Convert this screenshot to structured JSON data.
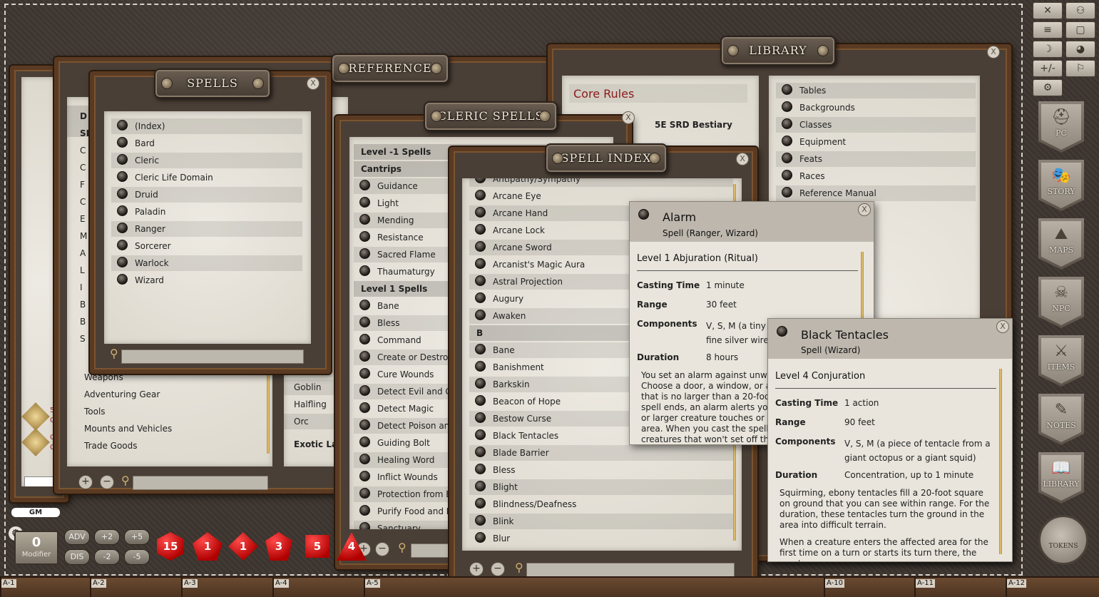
{
  "windows": {
    "spells": {
      "title": "SPELLS",
      "close": "X",
      "items": [
        "(Index)",
        "Bard",
        "Cleric",
        "Cleric Life Domain",
        "Druid",
        "Paladin",
        "Ranger",
        "Sorcerer",
        "Warlock",
        "Wizard"
      ]
    },
    "reference": {
      "title": "REFERENCE",
      "left_fragments": [
        "D",
        "SR",
        "C",
        "C",
        "F",
        "C",
        "E",
        "M",
        "A",
        "L",
        "I",
        "B",
        "B",
        "S"
      ],
      "items": [
        "Weapons",
        "Adventuring Gear",
        "Tools",
        "Mounts and Vehicles",
        "Trade Goods"
      ],
      "right_fragments": [
        "ng",
        "e",
        "ac",
        "er",
        "you",
        "a",
        "s",
        "th",
        "e",
        "cal",
        "e",
        "d L",
        "ge",
        "on",
        "sh"
      ],
      "right_items": [
        "Goblin",
        "Halfling",
        "Orc",
        "Exotic Lang"
      ]
    },
    "cleric_spells": {
      "title": "CLERIC SPELLS",
      "close": "X",
      "rows": [
        {
          "text": "Level -1 Spells",
          "kind": "header"
        },
        {
          "text": "Cantrips",
          "kind": "header"
        },
        {
          "text": "Guidance",
          "kind": "item"
        },
        {
          "text": "Light",
          "kind": "item"
        },
        {
          "text": "Mending",
          "kind": "item"
        },
        {
          "text": "Resistance",
          "kind": "item"
        },
        {
          "text": "Sacred Flame",
          "kind": "item"
        },
        {
          "text": "Thaumaturgy",
          "kind": "item"
        },
        {
          "text": "Level 1 Spells",
          "kind": "header"
        },
        {
          "text": "Bane",
          "kind": "item"
        },
        {
          "text": "Bless",
          "kind": "item"
        },
        {
          "text": "Command",
          "kind": "item"
        },
        {
          "text": "Create or Destroy Water",
          "kind": "item"
        },
        {
          "text": "Cure Wounds",
          "kind": "item"
        },
        {
          "text": "Detect Evil and Good",
          "kind": "item"
        },
        {
          "text": "Detect Magic",
          "kind": "item"
        },
        {
          "text": "Detect Poison and Disease",
          "kind": "item"
        },
        {
          "text": "Guiding Bolt",
          "kind": "item"
        },
        {
          "text": "Healing Word",
          "kind": "item"
        },
        {
          "text": "Inflict Wounds",
          "kind": "item"
        },
        {
          "text": "Protection from Evil and Good",
          "kind": "item"
        },
        {
          "text": "Purify Food and Drink",
          "kind": "item"
        },
        {
          "text": "Sanctuary",
          "kind": "item"
        }
      ]
    },
    "library": {
      "title": "LIBRARY",
      "close": "X",
      "left_header": "Core Rules",
      "left_items": [
        "5E SRD Bestiary"
      ],
      "right_items": [
        "Tables",
        "Backgrounds",
        "Classes",
        "Equipment",
        "Feats",
        "Races",
        "Reference Manual"
      ]
    },
    "spell_index": {
      "title": "SPELL INDEX",
      "close": "X",
      "rows": [
        {
          "text": "Antipathy/Sympathy",
          "kind": "item"
        },
        {
          "text": "Arcane Eye",
          "kind": "item"
        },
        {
          "text": "Arcane Hand",
          "kind": "item"
        },
        {
          "text": "Arcane Lock",
          "kind": "item"
        },
        {
          "text": "Arcane Sword",
          "kind": "item"
        },
        {
          "text": "Arcanist's Magic Aura",
          "kind": "item"
        },
        {
          "text": "Astral Projection",
          "kind": "item"
        },
        {
          "text": "Augury",
          "kind": "item"
        },
        {
          "text": "Awaken",
          "kind": "item"
        },
        {
          "text": "B",
          "kind": "header"
        },
        {
          "text": "Bane",
          "kind": "item"
        },
        {
          "text": "Banishment",
          "kind": "item"
        },
        {
          "text": "Barkskin",
          "kind": "item"
        },
        {
          "text": "Beacon of Hope",
          "kind": "item"
        },
        {
          "text": "Bestow Curse",
          "kind": "item"
        },
        {
          "text": "Black Tentacles",
          "kind": "item"
        },
        {
          "text": "Blade Barrier",
          "kind": "item"
        },
        {
          "text": "Bless",
          "kind": "item"
        },
        {
          "text": "Blight",
          "kind": "item"
        },
        {
          "text": "Blindness/Deafness",
          "kind": "item"
        },
        {
          "text": "Blink",
          "kind": "item"
        },
        {
          "text": "Blur",
          "kind": "item"
        }
      ]
    }
  },
  "popups": {
    "alarm": {
      "title": "Alarm",
      "subtitle": "Spell (Ranger, Wizard)",
      "level": "Level 1 Abjuration (Ritual)",
      "close": "X",
      "fields": [
        {
          "label": "Casting Time",
          "value": "1 minute"
        },
        {
          "label": "Range",
          "value": "30 feet"
        },
        {
          "label": "Components",
          "value": "V, S, M (a tiny bell and a piece of fine silver wire)"
        },
        {
          "label": "Duration",
          "value": "8 hours"
        }
      ],
      "description": "You set an alarm against unwanted intrusion. Choose a door, a window, or an area within range that is no larger than a 20-foot cube. Until the spell ends, an alarm alerts you whenever a Tiny or larger creature touches or enters the warded area. When you cast the spell, you can designate creatures that won't set off the alarm."
    },
    "black_tentacles": {
      "title": "Black Tentacles",
      "subtitle": "Spell (Wizard)",
      "level": "Level 4 Conjuration",
      "close": "X",
      "fields": [
        {
          "label": "Casting Time",
          "value": "1 action"
        },
        {
          "label": "Range",
          "value": "90 feet"
        },
        {
          "label": "Components",
          "value": "V, S, M (a piece of tentacle from a giant octopus or a giant squid)"
        },
        {
          "label": "Duration",
          "value": "Concentration, up to 1 minute"
        }
      ],
      "description": "Squirming, ebony tentacles fill a 20-foot square on ground that you can see within range. For the duration, these tentacles turn the ground in the area into difficult terrain.",
      "description2": "When a creature enters the affected area for the first time on a turn or starts its turn there, the creature"
    }
  },
  "chat": {
    "entries": [
      "5E",
      "Co",
      "Co",
      "Co"
    ],
    "gm_label": "GM"
  },
  "modifier": {
    "value": "0",
    "label": "Modifier"
  },
  "mod_buttons": [
    "ADV",
    "+2",
    "+5",
    "DIS",
    "-2",
    "-5"
  ],
  "dice": [
    "15",
    "1",
    "1",
    "3",
    "5",
    "4"
  ],
  "right_toolbar": {
    "buttons": [
      "✕",
      "⚇",
      "≡",
      "▢",
      "☽",
      "◕",
      "+/-",
      "⚐",
      "⚙"
    ],
    "shields": [
      "PC",
      "STORY",
      "MAPS",
      "NPC",
      "ITEMS",
      "NOTES",
      "LIBRARY"
    ],
    "tokens": "TOKENS"
  },
  "hotkeys": [
    "A-1",
    "A-2",
    "A-3",
    "A-4",
    "A-5",
    "A-10",
    "A-11",
    "A-12"
  ]
}
